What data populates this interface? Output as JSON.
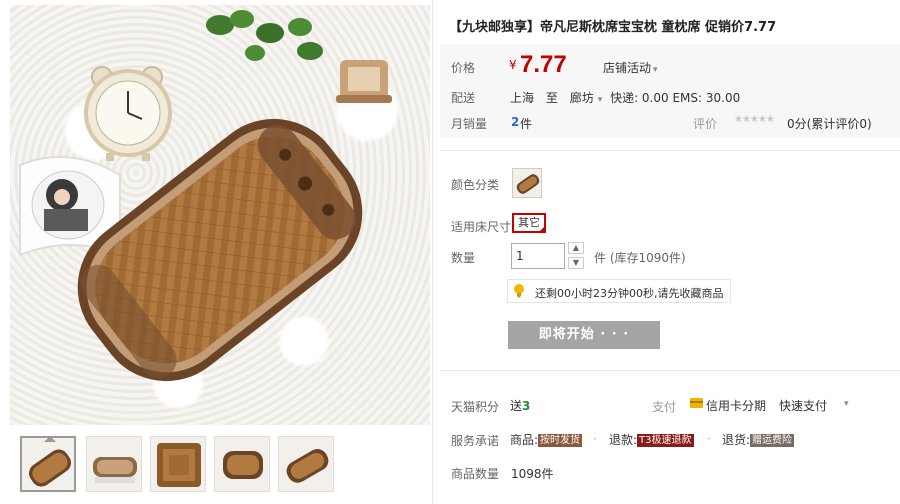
{
  "product": {
    "title": "【九块邮独享】帝凡尼斯枕席宝宝枕 童枕席 促销价7.77"
  },
  "price": {
    "label": "价格",
    "currency_symbol": "¥",
    "value": "7.77",
    "promo_link": "店铺活动",
    "promo_caret": "▾"
  },
  "shipping": {
    "label": "配送",
    "from": "上海",
    "to_word": "至",
    "destination": "廊坊",
    "dest_caret": "▾",
    "fees": "快递: 0.00 EMS: 30.00"
  },
  "sales": {
    "label": "月销量",
    "count": "2",
    "unit": "件"
  },
  "reviews": {
    "label": "评价",
    "stars": "★★★★★",
    "text": "0分(累计评价0)"
  },
  "color": {
    "label": "颜色分类"
  },
  "bed_size": {
    "label": "适用床尺寸",
    "option": "其它"
  },
  "quantity": {
    "label": "数量",
    "value": "1",
    "up": "▲",
    "down": "▼",
    "stock": "件 (库存1090件)"
  },
  "countdown": {
    "text": "还剩00小时23分钟00秒,请先收藏商品"
  },
  "start_button": {
    "label": "即将开始 · · ·"
  },
  "points": {
    "label": "天猫积分",
    "prefix": "送",
    "value": "3"
  },
  "payment": {
    "label": "支付",
    "credit_card": "信用卡分期",
    "quick_pay": "快速支付",
    "caret": "▾"
  },
  "service": {
    "label": "服务承诺",
    "goods_prefix": "商品:",
    "goods_tag": "按时发货",
    "refund_prefix": "退款:",
    "refund_tag": "T3极速退款",
    "return_prefix": "退货:",
    "return_tag": "赠运费险",
    "separator": "·"
  },
  "goods_count": {
    "label": "商品数量",
    "value": "1098件"
  },
  "colors": {
    "price_red": "#c40000",
    "button_gray": "#a5a5a5",
    "link_blue": "#3366cc",
    "points_green": "#2d8a2d",
    "tag_brown": "#8b5a3c",
    "tag_red": "#8b1a1a",
    "tag_gray": "#7a6a63",
    "mat_brown": "#a9743c",
    "mat_border": "#6b4428"
  },
  "icons": {
    "timer": "lightbulb-icon",
    "card": "credit-card-icon"
  }
}
